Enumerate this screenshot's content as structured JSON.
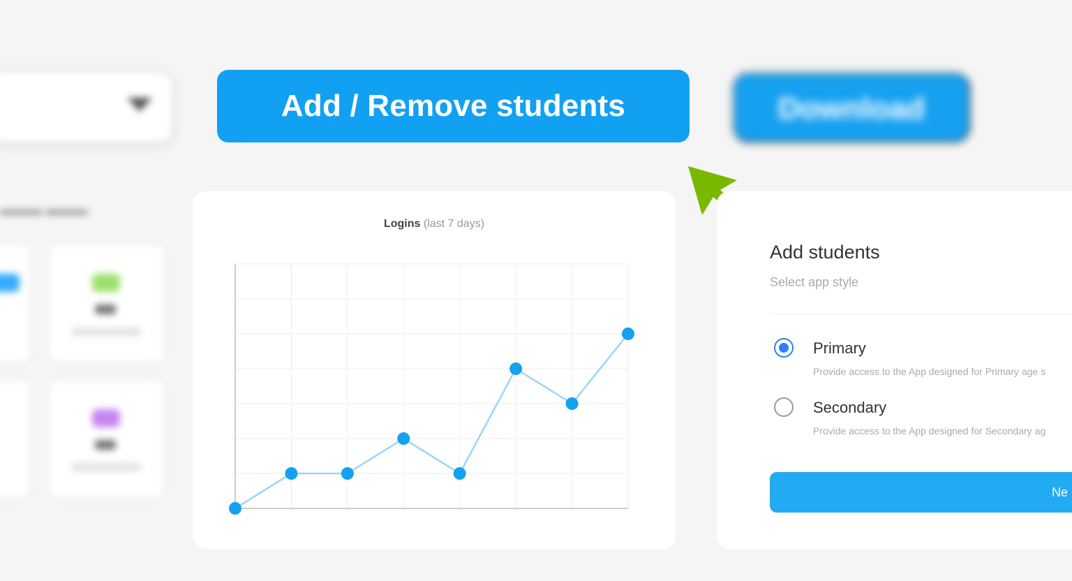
{
  "toolbar": {
    "add_remove_label": "Add / Remove students",
    "download_label": "Download"
  },
  "chart": {
    "title_bold": "Logins",
    "title_light": "(last 7 days)"
  },
  "chart_data": {
    "type": "line",
    "title": "Logins (last 7 days)",
    "x": [
      0,
      1,
      2,
      3,
      4,
      5,
      6,
      7
    ],
    "values": [
      0,
      1,
      1,
      2,
      1,
      4,
      3,
      5
    ],
    "ylim": [
      0,
      7
    ],
    "grid": true,
    "colors": {
      "line": "#9ad6f7",
      "point": "#16a0f0"
    }
  },
  "add_students": {
    "title": "Add students",
    "subtitle": "Select app style",
    "options": [
      {
        "label": "Primary",
        "description": "Provide access to the App designed for Primary age s",
        "checked": true
      },
      {
        "label": "Secondary",
        "description": "Provide access to the App designed for Secondary ag",
        "checked": false
      }
    ],
    "next_label": "Ne"
  },
  "colors": {
    "accent": "#12a1f2",
    "arrow": "#7ab800",
    "radio_selected": "#2f7ff2"
  }
}
